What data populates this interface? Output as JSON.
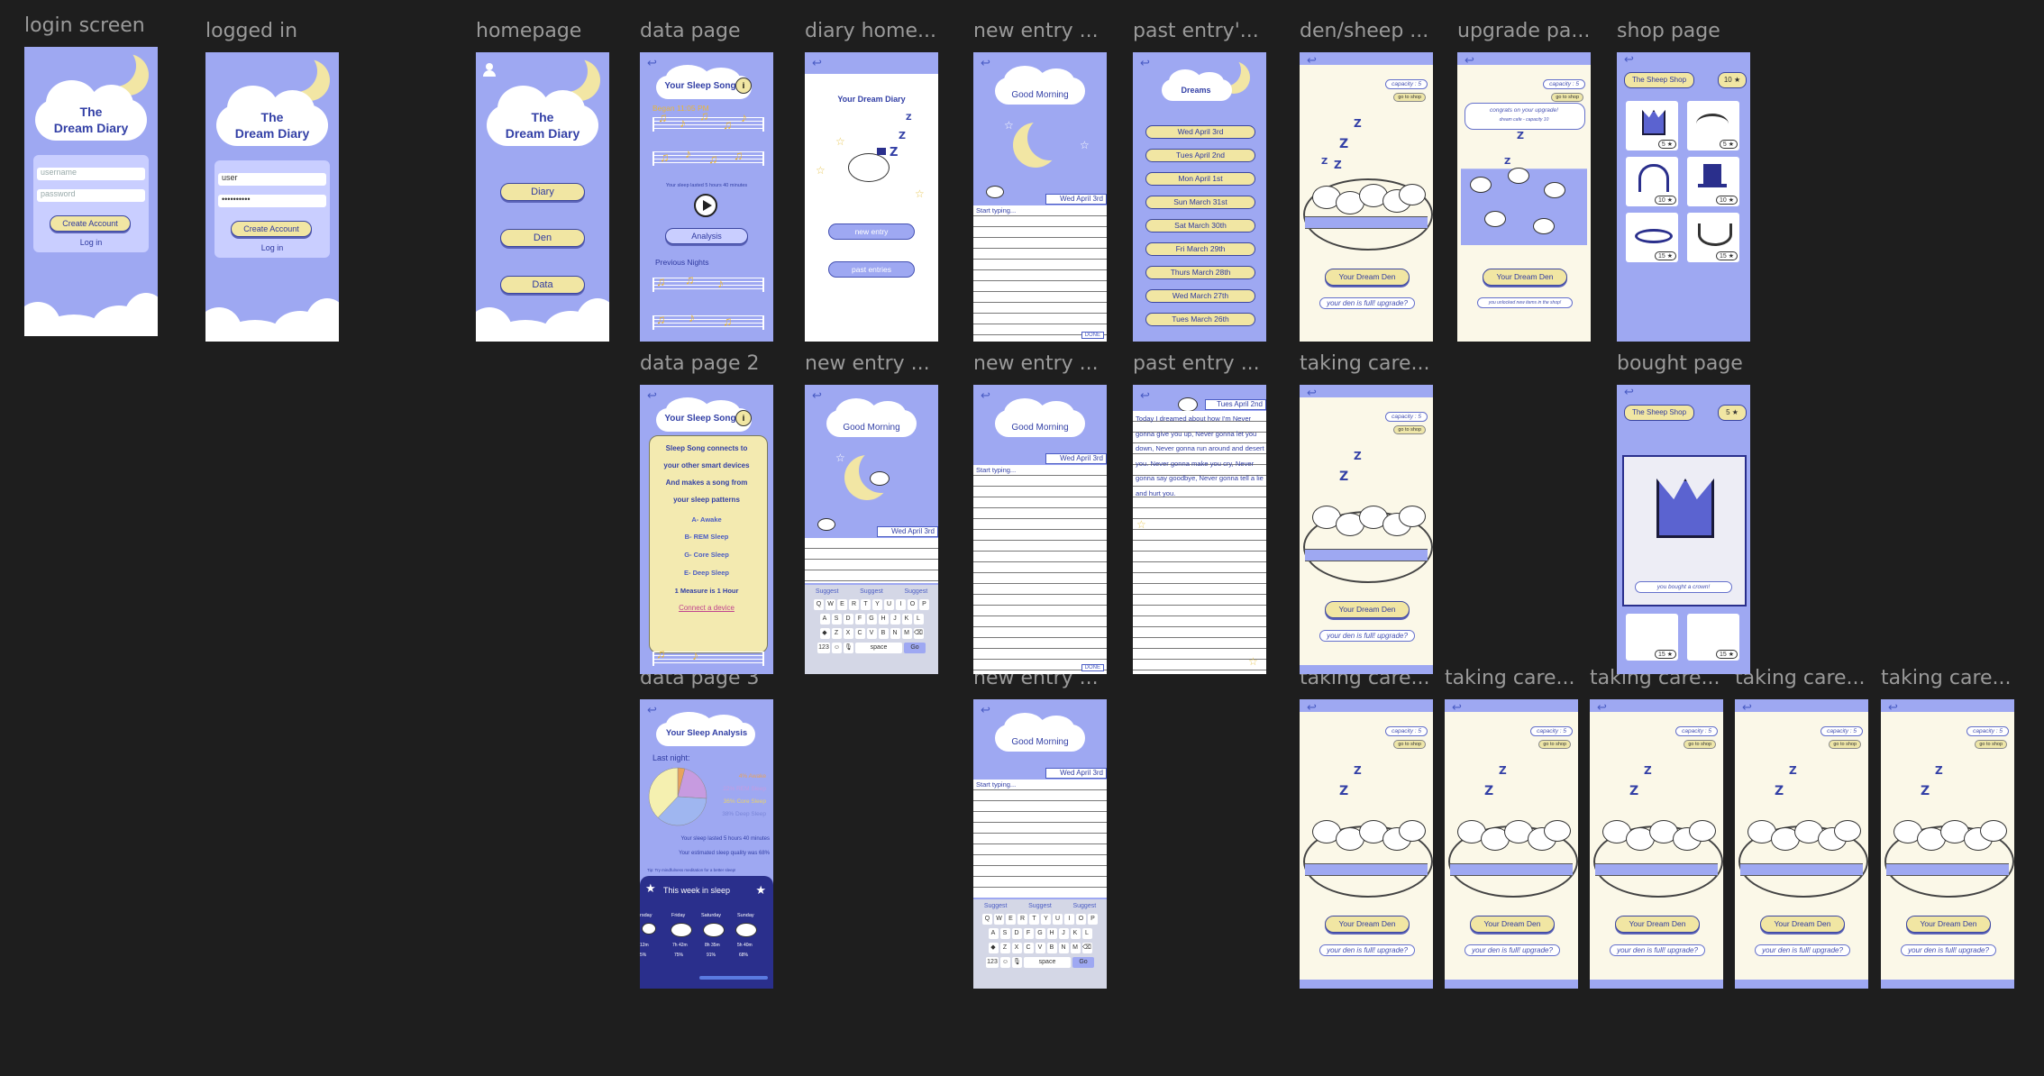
{
  "labels": {
    "login": "login screen",
    "logged_in": "logged in",
    "homepage": "homepage",
    "data_page": "data page",
    "diary_home": "diary home...",
    "new_entry_1": "new entry ...",
    "past_entries": "past entry'...",
    "den_sheep": "den/sheep ...",
    "upgrade": "upgrade pa...",
    "shop": "shop page",
    "data_page_2": "data page 2",
    "new_entry_2": "new entry ...",
    "new_entry_3": "new entry ...",
    "past_entry_2": "past entry ...",
    "taking_care_1": "taking care...",
    "bought": "bought page",
    "data_page_3": "data page 3",
    "new_entry_4": "new entry ...",
    "taking_care_2": "taking care...",
    "taking_care_3": "taking care...",
    "taking_care_4": "taking care...",
    "taking_care_5": "taking care...",
    "taking_care_6": "taking care..."
  },
  "app": {
    "title": "The Dream Diary",
    "title_line1": "The",
    "title_line2": "Dream Diary"
  },
  "login": {
    "username_placeholder": "username",
    "password_placeholder": "password",
    "create_account": "Create Account",
    "log_in": "Log in",
    "filled_user": "user",
    "filled_password": "••••••••••"
  },
  "homepage": {
    "buttons": [
      "Diary",
      "Den",
      "Data"
    ]
  },
  "data_page": {
    "title": "Your Sleep Song",
    "info_badge": "i",
    "began": "Began 11:05 PM",
    "summary": "Your sleep lasted 5 hours 40 minutes",
    "analysis": "Analysis",
    "previous": "Previous Nights"
  },
  "data_page_2": {
    "title": "Your Sleep Song",
    "lines": [
      "Sleep Song connects to",
      "your other smart devices",
      "And makes a song from",
      "your sleep patterns",
      "A- Awake",
      "B- REM Sleep",
      "G- Core Sleep",
      "E- Deep Sleep",
      "1 Measure is 1 Hour"
    ],
    "link": "Connect a device"
  },
  "data_page_3": {
    "title": "Your Sleep Analysis",
    "last_night": "Last night:",
    "legend": [
      "4% Awake",
      "22% REM Sleep",
      "36% Core Sleep",
      "38% Deep Sleep"
    ],
    "lasted": "Your sleep lasted 5 hours 40 minutes",
    "quality": "Your estimated sleep quality was 68%",
    "tip": "Tip: Try mindfulness meditation for a better sleep!",
    "week_title": "This week in sleep",
    "days": [
      "rsday",
      "Friday",
      "Saturday",
      "Sunday"
    ],
    "durations": [
      "12m",
      "7h 42m",
      "8h 35m",
      "5h 40m"
    ],
    "qualities": [
      "5%",
      "75%",
      "91%",
      "68%"
    ]
  },
  "chart_data": {
    "type": "pie",
    "categories": [
      "Awake",
      "REM Sleep",
      "Core Sleep",
      "Deep Sleep"
    ],
    "values": [
      4,
      22,
      36,
      38
    ],
    "colors": [
      "#e8a35c",
      "#c79be0",
      "#9fb6f0",
      "#f5f0b0"
    ]
  },
  "diary_home": {
    "title": "Your Dream Diary",
    "new_entry": "new entry",
    "past_entries": "past entries"
  },
  "entry": {
    "greeting": "Good Morning",
    "date": "Wed April 3rd",
    "start_typing": "Start typing...",
    "done": "DONE",
    "suggest": [
      "Suggest",
      "Suggest",
      "Suggest"
    ],
    "row1": [
      "Q",
      "W",
      "E",
      "R",
      "T",
      "Y",
      "U",
      "I",
      "O",
      "P"
    ],
    "row2": [
      "A",
      "S",
      "D",
      "F",
      "G",
      "H",
      "J",
      "K",
      "L"
    ],
    "row3": [
      "◆",
      "Z",
      "X",
      "C",
      "V",
      "B",
      "N",
      "M",
      "⌫"
    ],
    "space": "space",
    "go": "Go",
    "num": "123"
  },
  "past_entries": {
    "title": "Dreams",
    "dates": [
      "Wed April 3rd",
      "Tues April 2nd",
      "Mon April 1st",
      "Sun March 31st",
      "Sat March 30th",
      "Fri March 29th",
      "Thurs March 28th",
      "Wed March 27th",
      "Tues March 26th"
    ]
  },
  "past_entry_2": {
    "date": "Tues April 2nd",
    "text": "Today I dreamed about how I'm Never gonna give you up, Never gonna let you down, Never gonna run around and desert you. Never gonna make you cry, Never gonna say goodbye, Never gonna tell a lie and hurt you."
  },
  "den": {
    "capacity": "capacity : 5",
    "go_shop": "go to shop",
    "your_den": "Your Dream Den",
    "upgrade_q": "your den is full! upgrade?",
    "congrats": "congrats on your upgrade!",
    "new_cap": "dream cafe - capacity 10",
    "unlocked": "you unlocked new items in the shop!"
  },
  "shop": {
    "title": "The Sheep Shop",
    "coins": "10 ★",
    "coins_after": "5 ★",
    "prices": [
      "5 ★",
      "5 ★",
      "10 ★",
      "10 ★",
      "15 ★",
      "15 ★"
    ],
    "bought": "you bought a crown!"
  }
}
